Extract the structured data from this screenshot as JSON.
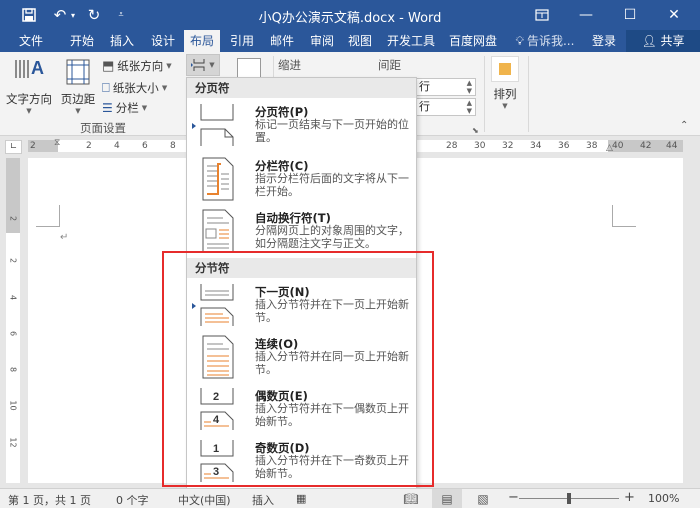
{
  "window": {
    "title": "小Q办公演示文稿.docx - Word",
    "controls": {
      "ribbon_display": "▭",
      "minimize": "—",
      "maximize": "☐",
      "close": "✕"
    }
  },
  "quick_access": {
    "save": "save-icon",
    "undo": "undo-icon",
    "redo": "redo-icon",
    "customize": "customize-icon"
  },
  "tabs": [
    {
      "label": "文件",
      "active": false
    },
    {
      "label": "开始",
      "active": false
    },
    {
      "label": "插入",
      "active": false
    },
    {
      "label": "设计",
      "active": false
    },
    {
      "label": "布局",
      "active": true
    },
    {
      "label": "引用",
      "active": false
    },
    {
      "label": "邮件",
      "active": false
    },
    {
      "label": "审阅",
      "active": false
    },
    {
      "label": "视图",
      "active": false
    },
    {
      "label": "开发工具",
      "active": false
    },
    {
      "label": "百度网盘",
      "active": false
    }
  ],
  "tell_me": "告诉我...",
  "login": "登录",
  "share": "共享",
  "ribbon": {
    "text_direction": "文字方向",
    "margins": "页边距",
    "orientation": "纸张方向",
    "size": "纸张大小",
    "columns": "分栏",
    "page_setup_group": "页面设置",
    "indent": "缩进",
    "spacing": "间距",
    "spin_unit_1": "行",
    "spin_unit_2": "行",
    "arrange": "排列"
  },
  "ruler": {
    "h_ticks": [
      "2",
      "2",
      "4",
      "6",
      "8",
      "28",
      "30",
      "32",
      "34",
      "36",
      "38",
      "40",
      "42",
      "44"
    ],
    "v_ticks": [
      "2",
      "2",
      "4",
      "6",
      "8",
      "10",
      "12"
    ]
  },
  "document": {
    "paragraph_mark": "↵"
  },
  "breaks_menu": {
    "page_breaks_header": "分页符",
    "section_breaks_header": "分节符",
    "page_breaks": [
      {
        "title": "分页符(P)",
        "desc": "标记一页结束与下一页开始的位置。",
        "icon": "page-break-icon"
      },
      {
        "title": "分栏符(C)",
        "desc": "指示分栏符后面的文字将从下一栏开始。",
        "icon": "column-break-icon"
      },
      {
        "title": "自动换行符(T)",
        "desc": "分隔网页上的对象周围的文字，如分隔题注文字与正文。",
        "icon": "text-wrapping-break-icon"
      }
    ],
    "section_breaks": [
      {
        "title": "下一页(N)",
        "desc": "插入分节符并在下一页上开始新节。",
        "icon": "next-page-break-icon"
      },
      {
        "title": "连续(O)",
        "desc": "插入分节符并在同一页上开始新节。",
        "icon": "continuous-break-icon"
      },
      {
        "title": "偶数页(E)",
        "desc": "插入分节符并在下一偶数页上开始新节。",
        "icon": "even-page-break-icon"
      },
      {
        "title": "奇数页(D)",
        "desc": "插入分节符并在下一奇数页上开始新节。",
        "icon": "odd-page-break-icon"
      }
    ]
  },
  "status": {
    "page": "第 1 页，共 1 页",
    "words": "0 个字",
    "language": "中文(中国)",
    "mode": "插入",
    "zoom": "100%",
    "zoom_percent": 100
  },
  "colors": {
    "accent": "#2b579a",
    "highlight": "#e62b2b",
    "section_orange": "#e8822e"
  }
}
